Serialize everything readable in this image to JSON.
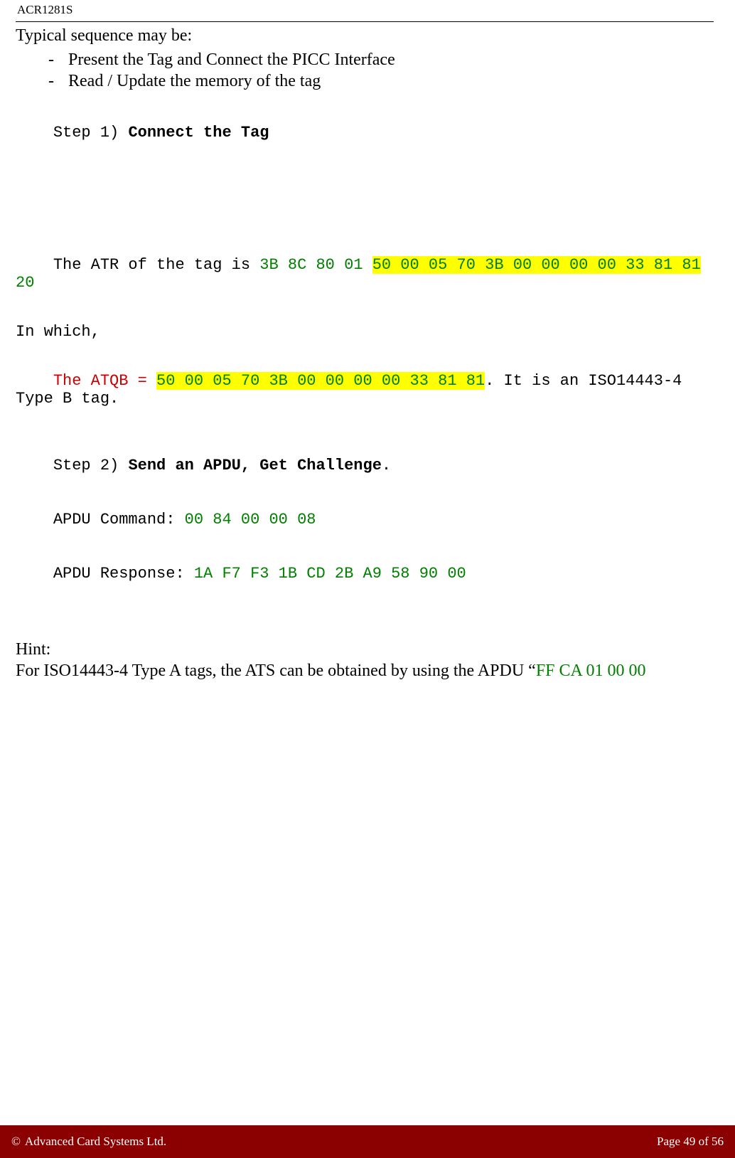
{
  "header": {
    "title": "ACR1281S"
  },
  "intro": "Typical sequence may be:",
  "bullets": [
    "Present the Tag and Connect the PICC Interface",
    "Read / Update the memory of the tag"
  ],
  "step1": {
    "prefix": "Step 1) ",
    "title": "Connect the Tag"
  },
  "atr": {
    "pre": "The ATR of the tag is ",
    "bytes_pre": "3B 8C 80 01 ",
    "bytes_hl": "50 00 05 70 3B 00 00 00 00 33 81 81",
    "bytes_post": " 20"
  },
  "in_which": "In which,",
  "atqb": {
    "label": "The ATQB = ",
    "bytes": "50 00 05 70 3B 00 00 00 00 33 81 81",
    "post": ". It is an ISO14443-4 Type B tag."
  },
  "step2": {
    "prefix": "Step 2) ",
    "title": "Send an APDU, Get Challenge",
    "dot": "."
  },
  "apdu": {
    "cmd_label": "APDU Command: ",
    "cmd": "00 84 00 00 08",
    "resp_label": "APDU Response: ",
    "resp": "1A F7 F3 1B CD 2B A9 58 90 00"
  },
  "hint": {
    "label": "Hint:",
    "line_pre": "For ISO14443-4 Type A tags, the ATS can be obtained by using the APDU “",
    "apdu": "FF CA 01 00 00"
  },
  "footer": {
    "copyright_symbol": "©",
    "copyright": "Advanced Card Systems Ltd.",
    "page_label": "Page 49 of 56"
  }
}
